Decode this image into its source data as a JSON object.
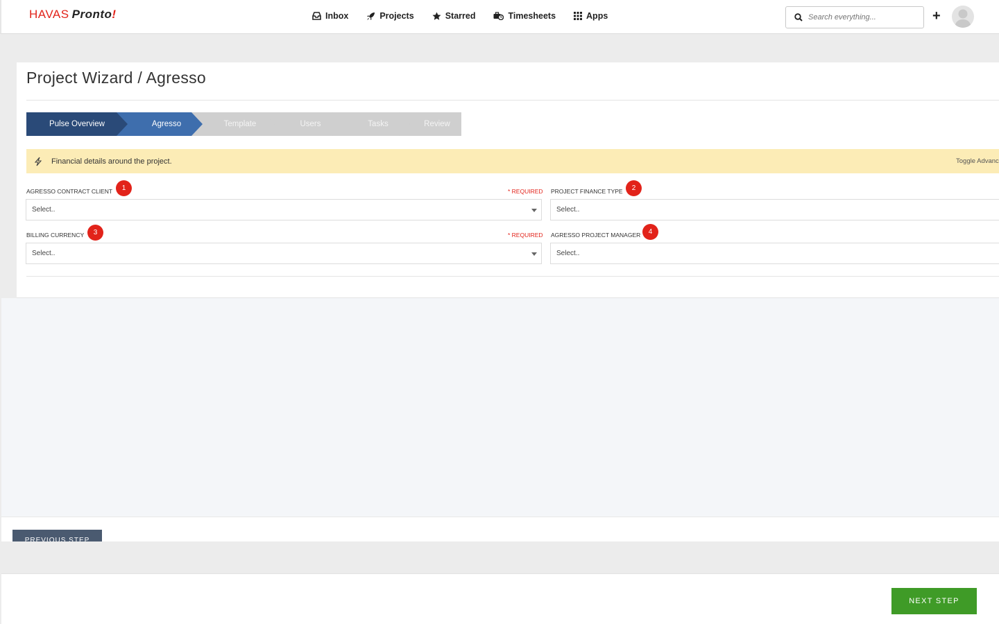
{
  "brand": {
    "word1": "HAVAS",
    "word2": "Pronto",
    "mark": "!"
  },
  "nav": {
    "items": [
      {
        "label": "Inbox",
        "icon": "inbox-icon"
      },
      {
        "label": "Projects",
        "icon": "rocket-icon"
      },
      {
        "label": "Starred",
        "icon": "star-icon"
      },
      {
        "label": "Timesheets",
        "icon": "briefcase-clock-icon"
      },
      {
        "label": "Apps",
        "icon": "grid-icon"
      }
    ],
    "search_placeholder": "Search everything...",
    "add_label": "+"
  },
  "page": {
    "title": "Project Wizard / Agresso"
  },
  "wizard": {
    "colors": {
      "done": "#2a4a78",
      "active": "#3e6ead",
      "pending": "#cfcfcf"
    },
    "steps": [
      {
        "label": "Pulse Overview",
        "state": "done"
      },
      {
        "label": "Agresso",
        "state": "active"
      },
      {
        "label": "Template",
        "state": "pending"
      },
      {
        "label": "Users",
        "state": "pending"
      },
      {
        "label": "Tasks",
        "state": "pending"
      },
      {
        "label": "Review",
        "state": "pending"
      }
    ]
  },
  "banner": {
    "text": "Financial details around the project.",
    "toggle": "Toggle Advanced",
    "icon": "bolt-icon"
  },
  "form": {
    "required_text": "* REQUIRED",
    "fields": {
      "contract_client": {
        "label": "AGRESSO CONTRACT CLIENT",
        "badge": "1",
        "value": "Select..",
        "required": true
      },
      "finance_type": {
        "label": "PROJECT FINANCE TYPE",
        "badge": "2",
        "value": "Select.."
      },
      "billing_currency": {
        "label": "BILLING CURRENCY",
        "badge": "3",
        "value": "Select..",
        "required": true
      },
      "project_manager": {
        "label": "AGRESSO PROJECT MANAGER",
        "badge": "4",
        "value": "Select.."
      }
    }
  },
  "footer": {
    "prev_label": "PREVIOUS STEP",
    "next_label": "NEXT STEP"
  }
}
